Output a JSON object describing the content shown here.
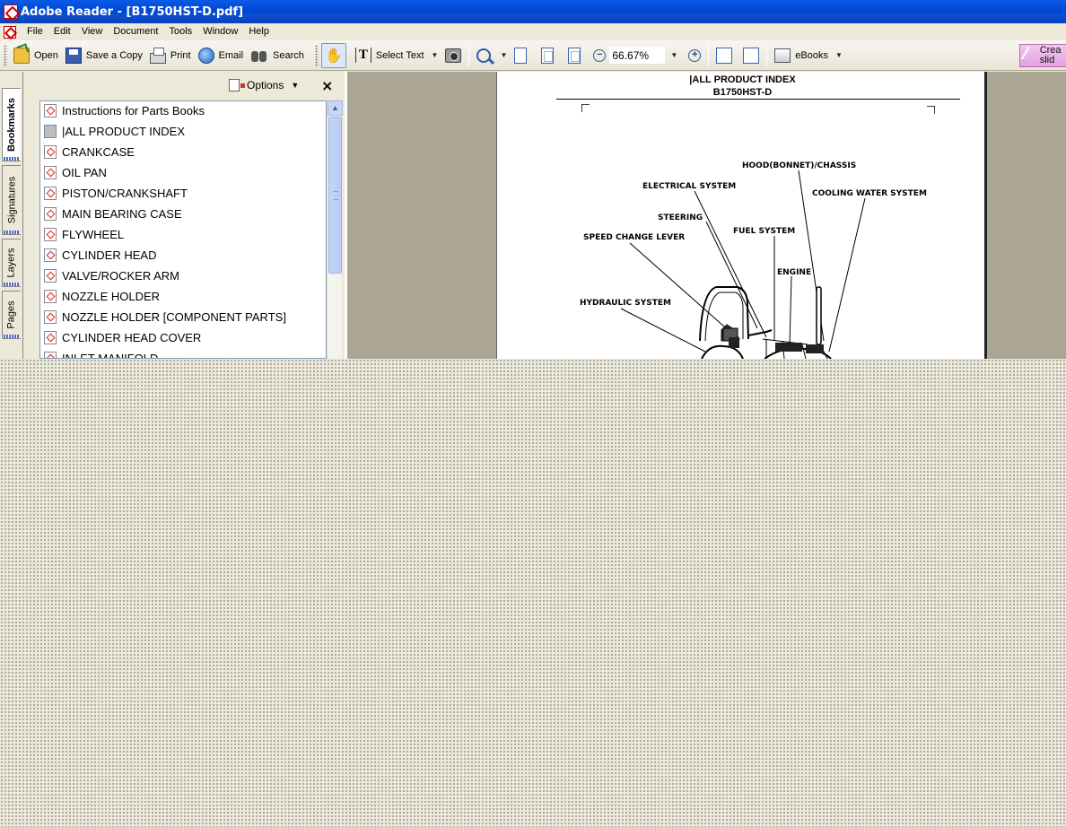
{
  "window": {
    "title": "Adobe Reader - [B1750HST-D.pdf]"
  },
  "menu": {
    "items": [
      "File",
      "Edit",
      "View",
      "Document",
      "Tools",
      "Window",
      "Help"
    ]
  },
  "toolbar": {
    "open_label": "Open",
    "save_label": "Save a Copy",
    "print_label": "Print",
    "email_label": "Email",
    "search_label": "Search",
    "select_text_label": "Select Text",
    "zoom_value": "66.67%",
    "ebooks_label": "eBooks",
    "create_label": "Crea slid"
  },
  "nav_tabs": [
    "Bookmarks",
    "Signatures",
    "Layers",
    "Pages"
  ],
  "bookmarks": {
    "options_label": "Options",
    "close_label": "×",
    "items": [
      "Instructions for Parts Books",
      "|ALL PRODUCT INDEX",
      "CRANKCASE",
      "OIL PAN",
      "PISTON/CRANKSHAFT",
      "MAIN BEARING CASE",
      "FLYWHEEL",
      "CYLINDER HEAD",
      "VALVE/ROCKER ARM",
      "NOZZLE HOLDER",
      "NOZZLE HOLDER [COMPONENT PARTS]",
      "CYLINDER HEAD COVER",
      "INLET MANIFOLD"
    ]
  },
  "document": {
    "title_line1": "|ALL PRODUCT INDEX",
    "title_line2": "B1750HST-D",
    "labels": {
      "hood": "HOOD(BONNET)/CHASSIS",
      "electrical": "ELECTRICAL SYSTEM",
      "cooling": "COOLING WATER SYSTEM",
      "steering": "STEERING",
      "fuel": "FUEL SYSTEM",
      "speed": "SPEED CHANGE LEVER",
      "engine": "ENGINE",
      "hydraulic": "HYDRAULIC SYSTEM"
    }
  }
}
